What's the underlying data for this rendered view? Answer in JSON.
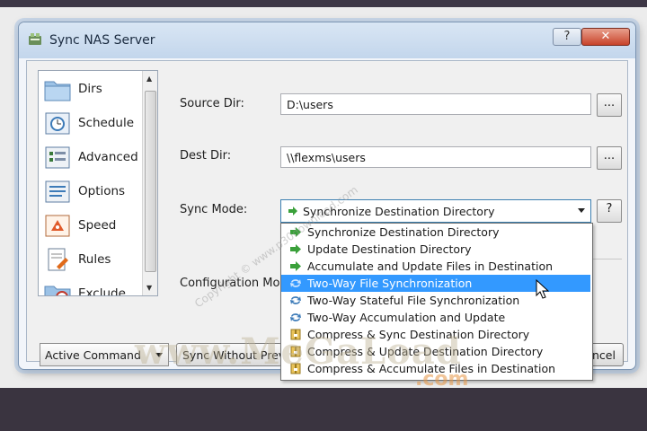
{
  "window": {
    "title": "Sync NAS Server",
    "help_label": "?",
    "close_label": "✕"
  },
  "sidebar": {
    "items": [
      {
        "label": "Dirs",
        "icon": "folder-icon"
      },
      {
        "label": "Schedule",
        "icon": "schedule-icon"
      },
      {
        "label": "Advanced",
        "icon": "advanced-icon"
      },
      {
        "label": "Options",
        "icon": "options-icon"
      },
      {
        "label": "Speed",
        "icon": "speed-icon"
      },
      {
        "label": "Rules",
        "icon": "rules-icon"
      },
      {
        "label": "Exclude",
        "icon": "exclude-icon"
      }
    ]
  },
  "form": {
    "source_label": "Source Dir:",
    "source_value": "D:\\users",
    "dest_label": "Dest Dir:",
    "dest_value": "\\\\flexms\\users",
    "browse_label": "...",
    "sync_mode_label": "Sync Mode:",
    "sync_mode_value": "Synchronize Destination Directory",
    "sync_help_label": "?",
    "config_label": "Configuration Mod"
  },
  "dropdown": {
    "options": [
      {
        "label": "Synchronize Destination Directory",
        "icon": "green-arrow-icon"
      },
      {
        "label": "Update Destination Directory",
        "icon": "green-arrow-icon"
      },
      {
        "label": "Accumulate and Update Files in Destination",
        "icon": "green-arrow-icon"
      },
      {
        "label": "Two-Way File Synchronization",
        "icon": "two-way-sync-icon",
        "selected": true
      },
      {
        "label": "Two-Way Stateful File Synchronization",
        "icon": "two-way-sync-icon"
      },
      {
        "label": "Two-Way Accumulation and Update",
        "icon": "two-way-sync-icon"
      },
      {
        "label": "Compress & Sync Destination Directory",
        "icon": "compress-icon"
      },
      {
        "label": "Compress & Update Destination Directory",
        "icon": "compress-icon"
      },
      {
        "label": "Compress & Accumulate Files in Destination",
        "icon": "compress-icon"
      }
    ]
  },
  "bottom": {
    "command_value": "Active Command",
    "sync_without_preview": "Sync Without Prev",
    "cancel_label": "ncel"
  },
  "watermarks": {
    "diagonal": "Copyright © www.p30download.com",
    "big": "www.MeGaLoad",
    "com": ".com"
  },
  "colors": {
    "accent_selected": "#3399ff",
    "close_button": "#c8432a"
  }
}
